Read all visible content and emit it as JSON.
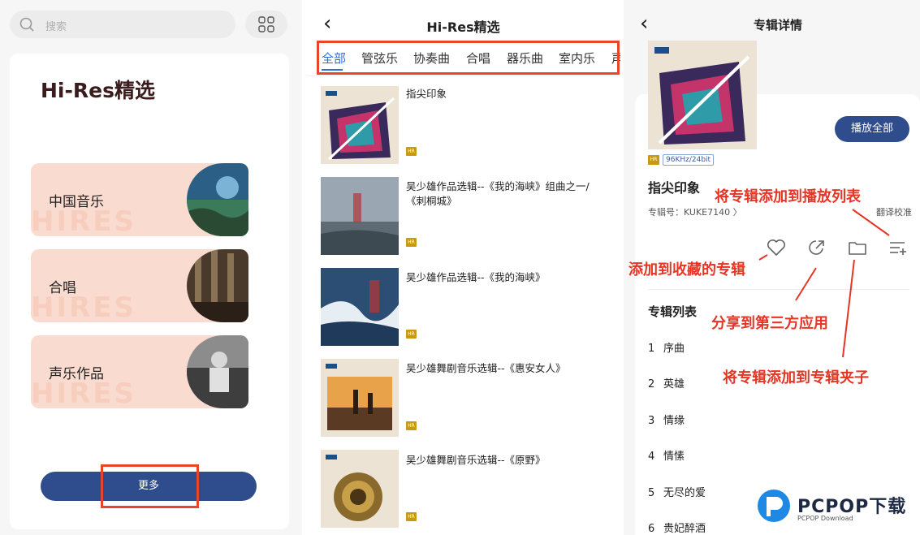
{
  "panel1": {
    "search_placeholder": "搜索",
    "section_title": "Hi-Res精选",
    "categories": [
      {
        "label": "中国音乐",
        "watermark": "HIRES"
      },
      {
        "label": "合唱",
        "watermark": "HIRES"
      },
      {
        "label": "声乐作品",
        "watermark": "HIRES"
      }
    ],
    "more_button": "更多"
  },
  "panel2": {
    "title": "Hi-Res精选",
    "tabs": [
      "全部",
      "管弦乐",
      "协奏曲",
      "合唱",
      "器乐曲",
      "室内乐",
      "声"
    ],
    "albums": [
      {
        "title": "指尖印象"
      },
      {
        "title": "吴少雄作品选辑--《我的海峡》组曲之一/《刺桐城》"
      },
      {
        "title": "吴少雄作品选辑--《我的海峡》"
      },
      {
        "title": "吴少雄舞剧音乐选辑--《惠安女人》"
      },
      {
        "title": "吴少雄舞剧音乐选辑--《原野》"
      }
    ]
  },
  "panel3": {
    "title": "专辑详情",
    "play_all": "播放全部",
    "quality": "96KHz/24bit",
    "album_name": "指尖印象",
    "album_code": "专辑号：KUKE7140 〉",
    "translate": "翻译校准",
    "tracklist_title": "专辑列表",
    "tracks": [
      {
        "no": "1",
        "name": "序曲"
      },
      {
        "no": "2",
        "name": "英雄"
      },
      {
        "no": "3",
        "name": "情缘"
      },
      {
        "no": "4",
        "name": "情愫"
      },
      {
        "no": "5",
        "name": "无尽的爱"
      },
      {
        "no": "6",
        "name": "贵妃醉酒"
      }
    ]
  },
  "annotations": {
    "add_playlist": "将专辑添加到播放列表",
    "add_favorite": "添加到收藏的专辑",
    "share": "分享到第三方应用",
    "add_folder": "将专辑添加到专辑夹子"
  },
  "logo": {
    "text": "PCPOP下载",
    "sub": "PCPOP Download"
  },
  "colors": {
    "accent": "#2f4d8c",
    "highlight": "#e8452b",
    "annotation": "#e63524",
    "card_peach": "#fadbcf",
    "tab_active": "#2f6fd6"
  }
}
